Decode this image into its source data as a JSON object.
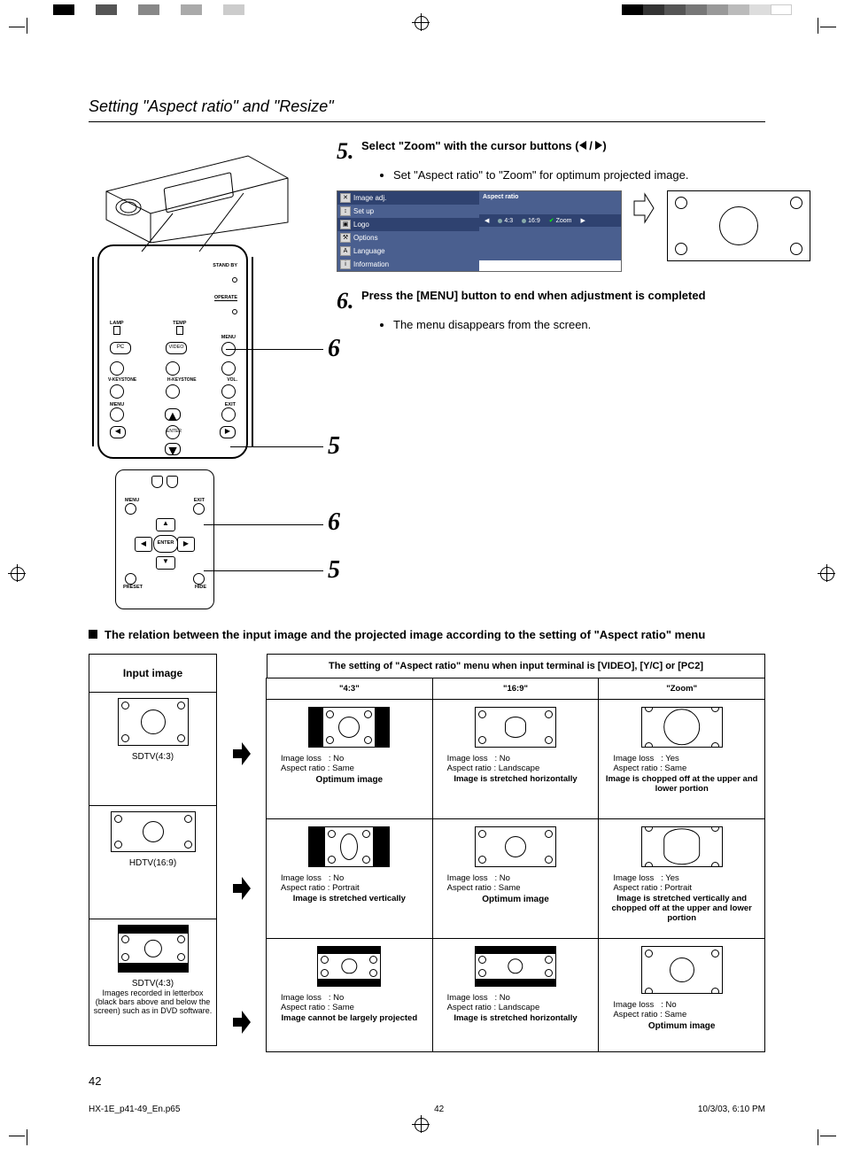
{
  "header_title": "Setting \"Aspect ratio\" and \"Resize\"",
  "step5": {
    "num": "5.",
    "title": "Select \"Zoom\" with the cursor buttons  (",
    "title_end": ")",
    "bullet": "Set \"Aspect ratio\" to \"Zoom\" for optimum projected image."
  },
  "osd": {
    "items": [
      "Image adj.",
      "Set up",
      "Logo",
      "Options",
      "Language",
      "Information"
    ],
    "right_header": "Aspect ratio",
    "options": [
      "4:3",
      "16:9",
      "Zoom"
    ]
  },
  "step6": {
    "num": "6.",
    "title": "Press the [MENU] button to end when adjustment is completed",
    "bullet": "The menu disappears from the screen."
  },
  "callouts": {
    "panel_row1": "6",
    "panel_row2": "5",
    "remote_row1": "6",
    "remote_row2": "5"
  },
  "panel_labels": {
    "standby": "STAND BY",
    "operate": "OPERATE",
    "lamp": "LAMP",
    "temp": "TEMP",
    "pc": "PC",
    "video": "VIDEO",
    "menu": "MENU",
    "vkey": "V-KEYSTONE",
    "hkey": "H-KEYSTONE",
    "vol": "VOL.",
    "menu2": "MENU",
    "exit": "EXIT",
    "enter": "ENTER"
  },
  "remote_labels": {
    "menu": "MENU",
    "exit": "EXIT",
    "enter": "ENTER",
    "preset": "PRESET",
    "hide": "HIDE"
  },
  "relation_heading": "The relation between the input image and the projected image according to the setting of \"Aspect ratio\" menu",
  "table": {
    "input_header": "Input image",
    "setting_header": "The setting of \"Aspect ratio\" menu when input terminal is [VIDEO], [Y/C] or [PC2]",
    "cols": [
      "\"4:3\"",
      "\"16:9\"",
      "\"Zoom\""
    ],
    "inputs": [
      {
        "label": "SDTV(4:3)",
        "sub": ""
      },
      {
        "label": "HDTV(16:9)",
        "sub": ""
      },
      {
        "label": "SDTV(4:3)",
        "sub": "Images recorded in letterbox (black bars above and below the screen) such as in DVD software."
      }
    ],
    "results": [
      [
        {
          "loss": "No",
          "ar": "Same",
          "note": "Optimum image",
          "opt": true
        },
        {
          "loss": "No",
          "ar": "Landscape",
          "note": "Image is stretched horizontally",
          "opt": false
        },
        {
          "loss": "Yes",
          "ar": "Same",
          "note": "Image is chopped off at the upper and lower portion",
          "opt": false
        }
      ],
      [
        {
          "loss": "No",
          "ar": "Portrait",
          "note": "Image is stretched vertically",
          "opt": false
        },
        {
          "loss": "No",
          "ar": "Same",
          "note": "Optimum image",
          "opt": true
        },
        {
          "loss": "Yes",
          "ar": "Portrait",
          "note": "Image is stretched vertically and chopped off at the upper and lower portion",
          "opt": false
        }
      ],
      [
        {
          "loss": "No",
          "ar": "Same",
          "note": "Image cannot be largely projected",
          "opt": false
        },
        {
          "loss": "No",
          "ar": "Landscape",
          "note": "Image is stretched horizontally",
          "opt": false
        },
        {
          "loss": "No",
          "ar": "Same",
          "note": "Optimum image",
          "opt": true
        }
      ]
    ],
    "labels": {
      "image_loss": "Image loss",
      "aspect_ratio": "Aspect ratio"
    }
  },
  "page_number": "42",
  "footer": {
    "file": "HX-1E_p41-49_En.p65",
    "page": "42",
    "date": "10/3/03, 6:10 PM"
  }
}
